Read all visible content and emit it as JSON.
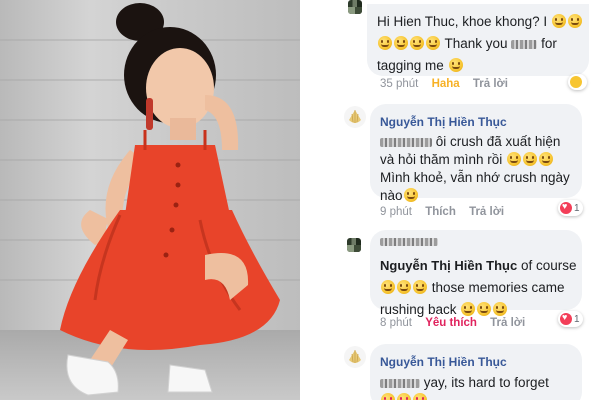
{
  "comments": [
    {
      "lines": [
        [
          "Hi Hien Thuc, khoe khong? I",
          "emoji",
          "emoji"
        ],
        [
          "emoji",
          "emoji",
          "emoji",
          "emoji",
          "Thank you",
          "blur",
          "for"
        ],
        [
          "tagging me",
          "emoji"
        ]
      ],
      "time": "35 phút",
      "reaction_action": "Haha",
      "reply": "Trả lời"
    },
    {
      "author": "Nguyễn Thị Hiền Thục",
      "line1_text": "ôi crush đã xuất hiện",
      "line2_text": "và hỏi thăm mình rồi",
      "line3_text": "Mình khoẻ, vẫn nhớ crush ngày",
      "line4_text": "nào",
      "time": "9 phút",
      "like": "Thích",
      "reply": "Trả lời",
      "reaction_count": "1"
    },
    {
      "author": "Nguyễn Thị Hiền Thục",
      "line1_suffix": "of course",
      "line2_text": "those memories came",
      "line3_text": "rushing back",
      "time": "8 phút",
      "reaction_action": "Yêu thích",
      "reply": "Trả lời",
      "reaction_count": "1"
    },
    {
      "author": "Nguyễn Thị Hiền Thục",
      "line1_text": "yay, its hard to forget"
    }
  ],
  "colors": {
    "bubble_bg": "#f0f2f5",
    "name_blue": "#385898",
    "meta_gray": "#90949c",
    "haha_yellow": "#f7b125",
    "love_red": "#e0245e",
    "dress_red": "#e8442a"
  },
  "icons": [
    "pixelated-avatar",
    "shell-avatar",
    "smile-emoji",
    "heart-eyes-emoji",
    "haha-reaction-icon",
    "heart-reaction-icon"
  ]
}
